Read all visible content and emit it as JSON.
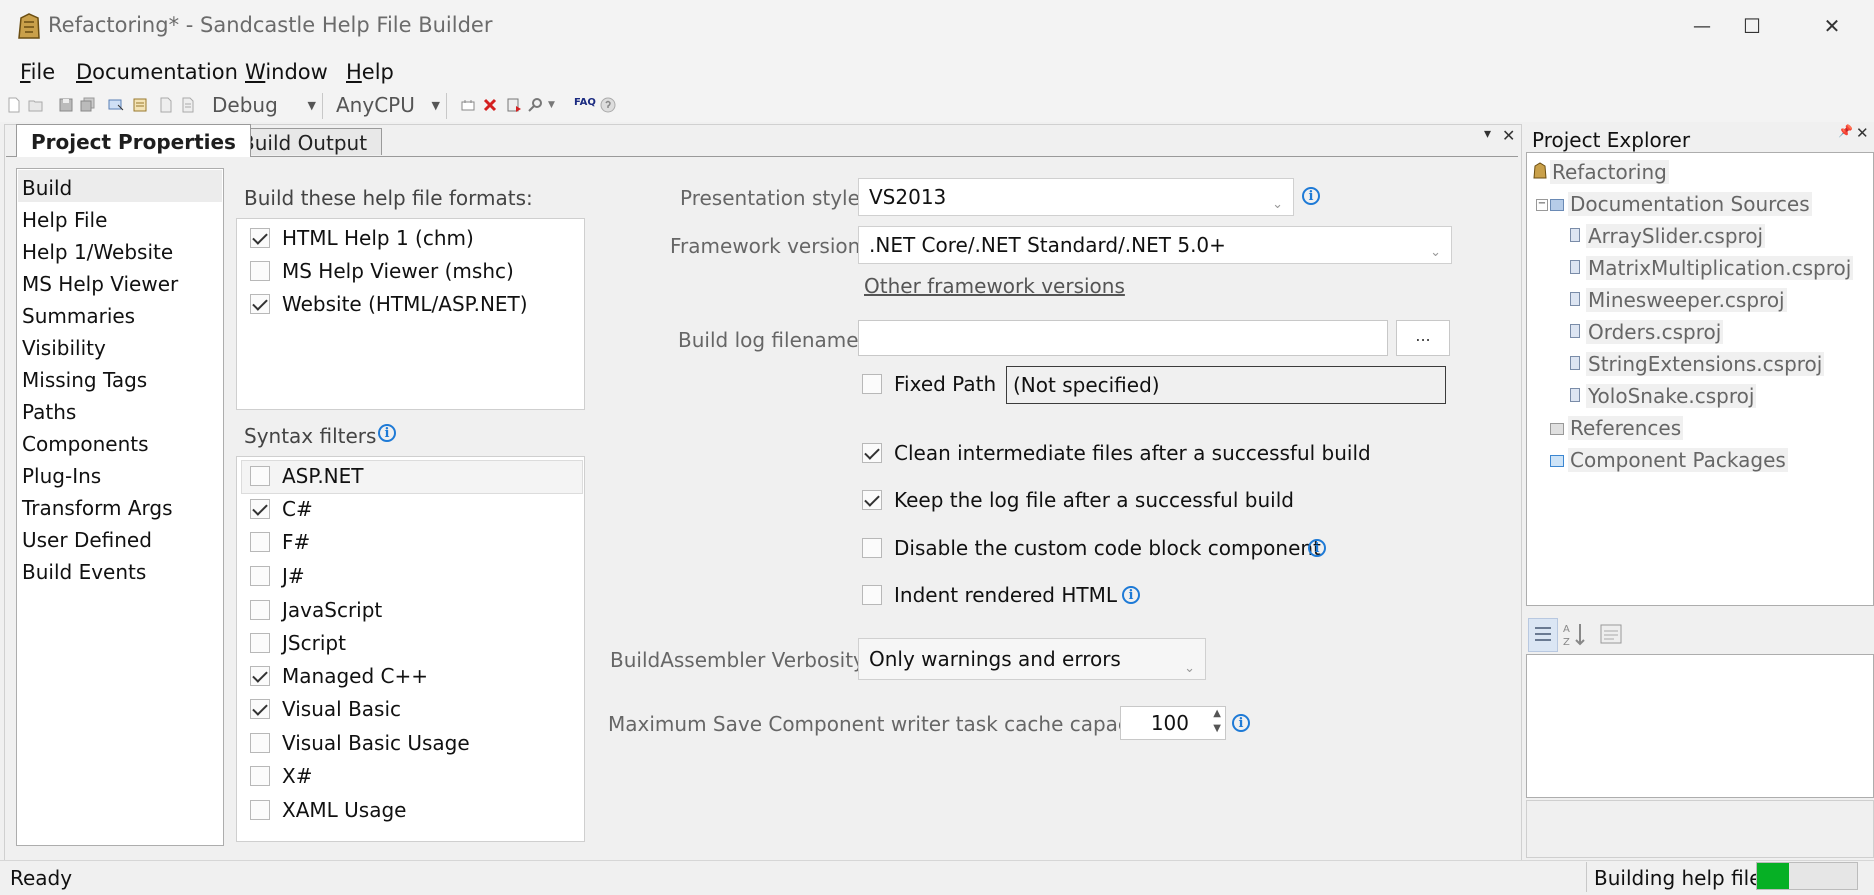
{
  "window": {
    "title": "Refactoring* - Sandcastle Help File Builder",
    "minimize_glyph": "—",
    "maximize_glyph": "☐",
    "close_glyph": "✕"
  },
  "menu": {
    "file": {
      "u": "F",
      "rest": "ile"
    },
    "documentation": {
      "u": "D",
      "rest": "ocumentation"
    },
    "window": {
      "u": "W",
      "rest": "indow"
    },
    "help": {
      "u": "H",
      "rest": "elp"
    }
  },
  "toolbar": {
    "configuration": "Debug",
    "platform": "AnyCPU",
    "faq_label": "FAQ"
  },
  "tabs": {
    "properties": "Project Properties",
    "build_output": "Build Output",
    "pin_glyph": "▾",
    "close_glyph": "✕"
  },
  "nav": {
    "items": [
      "Build",
      "Help File",
      "Help 1/Website",
      "MS Help Viewer",
      "Summaries",
      "Visibility",
      "Missing Tags",
      "Paths",
      "Components",
      "Plug-Ins",
      "Transform Args",
      "User Defined",
      "Build Events"
    ],
    "selected": "Build"
  },
  "build": {
    "formats_label": "Build these help file formats:",
    "formats": [
      {
        "label": "HTML Help 1 (chm)",
        "checked": true
      },
      {
        "label": "MS Help Viewer (mshc)",
        "checked": false
      },
      {
        "label": "Website (HTML/ASP.NET)",
        "checked": true
      }
    ],
    "syntax_label": "Syntax filters",
    "syntax_filters": [
      {
        "label": "ASP.NET",
        "checked": false
      },
      {
        "label": "C#",
        "checked": true
      },
      {
        "label": "F#",
        "checked": false
      },
      {
        "label": "J#",
        "checked": false
      },
      {
        "label": "JavaScript",
        "checked": false
      },
      {
        "label": "JScript",
        "checked": false
      },
      {
        "label": "Managed C++",
        "checked": true
      },
      {
        "label": "Visual Basic",
        "checked": true
      },
      {
        "label": "Visual Basic Usage",
        "checked": false
      },
      {
        "label": "X#",
        "checked": false
      },
      {
        "label": "XAML Usage",
        "checked": false
      }
    ],
    "presentation_style_label": "Presentation style",
    "presentation_style_value": "VS2013",
    "framework_label": "Framework version",
    "framework_value": ".NET Core/.NET Standard/.NET 5.0+",
    "other_framework_link": "Other framework versions",
    "build_log_label": "Build log filename",
    "build_log_value": "",
    "browse_label": "...",
    "fixed_path_label": "Fixed Path",
    "fixed_path_value": "(Not specified)",
    "clean_label": "Clean intermediate files after a successful build",
    "keep_log_label": "Keep the log file after a successful build",
    "disable_code_block_label": "Disable the custom code block component",
    "indent_html_label": "Indent rendered HTML",
    "verbosity_label": "BuildAssembler Verbosity",
    "verbosity_value": "Only warnings and errors",
    "cache_label": "Maximum Save Component writer task cache capacity",
    "cache_value": "100",
    "info_glyph": "i"
  },
  "project_explorer": {
    "title": "Project Explorer",
    "root": "Refactoring",
    "doc_sources": "Documentation Sources",
    "files": [
      "ArraySlider.csproj",
      "MatrixMultiplication.csproj",
      "Minesweeper.csproj",
      "Orders.csproj",
      "StringExtensions.csproj",
      "YoloSnake.csproj"
    ],
    "references": "References",
    "component_packages": "Component Packages"
  },
  "status": {
    "left": "Ready",
    "right": "Building help file",
    "progress_fraction": 0.33
  }
}
